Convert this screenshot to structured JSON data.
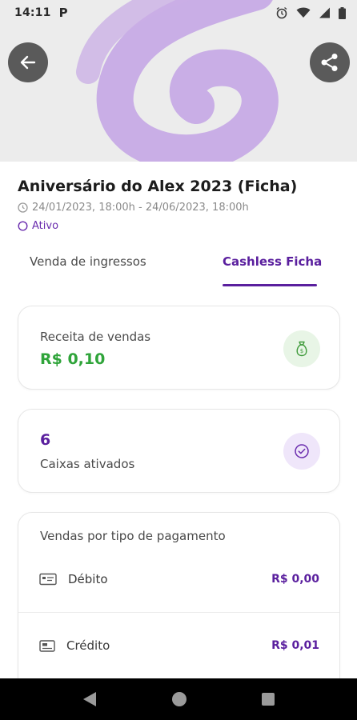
{
  "status_bar": {
    "time": "14:11",
    "app_letter": "P",
    "icons": [
      "alarm-icon",
      "wifi-icon",
      "signal-icon",
      "battery-icon"
    ]
  },
  "banner": {
    "back_icon": "arrow-left-icon",
    "share_icon": "share-icon",
    "logo": "purple-swirl-logo"
  },
  "event": {
    "title": "Aniversário do Alex 2023 (Ficha)",
    "dates": "24/01/2023, 18:00h - 24/06/2023, 18:00h",
    "status": "Ativo"
  },
  "tabs": [
    {
      "label": "Venda de ingressos",
      "active": false
    },
    {
      "label": "Cashless Ficha",
      "active": true
    }
  ],
  "revenue": {
    "label": "Receita de vendas",
    "value": "R$ 0,10",
    "icon": "money-bag-icon"
  },
  "caixas": {
    "count": "6",
    "label": "Caixas ativados",
    "icon": "check-circle-icon"
  },
  "payments": {
    "title": "Vendas por tipo de pagamento",
    "rows": [
      {
        "name": "Débito",
        "amount": "R$ 0,00",
        "icon": "debit-card-icon"
      },
      {
        "name": "Crédito",
        "amount": "R$ 0,01",
        "icon": "credit-card-icon"
      }
    ]
  },
  "colors": {
    "accent": "#5a1f9e",
    "success": "#2fa43a",
    "banner_bg": "#ececec",
    "logo": "#c9aee6"
  },
  "nav": {
    "back": "nav-back-icon",
    "home": "nav-home-icon",
    "recents": "nav-recents-icon"
  }
}
